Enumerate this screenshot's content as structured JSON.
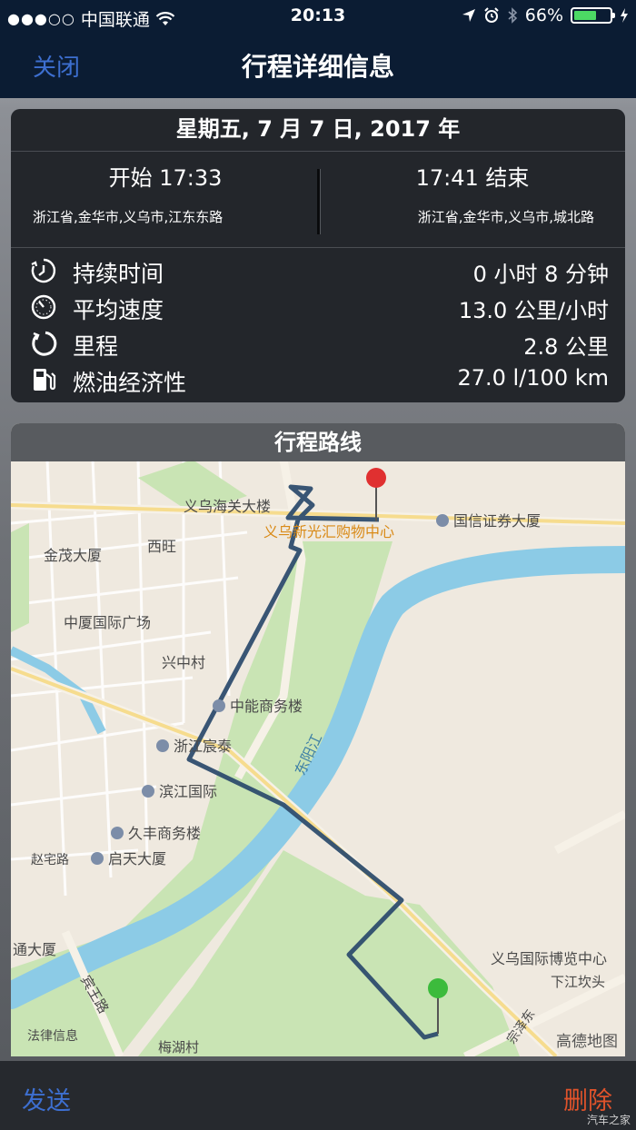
{
  "status_bar": {
    "carrier": "中国联通",
    "time": "20:13",
    "battery": "66%",
    "battery_level": 0.66
  },
  "nav": {
    "close_label": "关闭",
    "title": "行程详细信息"
  },
  "trip": {
    "date": "星期五, 7 月 7 日, 2017 年",
    "start_time": "开始 17:33",
    "end_time": "17:41 结束",
    "start_address": "浙江省,金华市,义乌市,江东东路",
    "end_address": "浙江省,金华市,义乌市,城北路"
  },
  "stats": [
    {
      "icon": "stopwatch-icon",
      "label": "持续时间",
      "value": "0 小时 8 分钟"
    },
    {
      "icon": "speedometer-icon",
      "label": "平均速度",
      "value": "13.0 公里/小时"
    },
    {
      "icon": "odometer-icon",
      "label": "里程",
      "value": "2.8 公里"
    },
    {
      "icon": "fuel-pump-icon",
      "label": "燃油经济性",
      "value": "27.0 l/100 km"
    }
  ],
  "map": {
    "title": "行程路线",
    "labels": {
      "customs": "义乌海关大楼",
      "mall": "义乌新光汇购物中心",
      "guoxin": "国信证券大厦",
      "xiwang": "西旺",
      "jinmao": "金茂大厦",
      "zhongxia": "中厦国际广场",
      "xingzhong": "兴中村",
      "zhongneng": "中能商务楼",
      "river": "东阳江",
      "chentai": "浙江宸泰",
      "binjiang": "滨江国际",
      "jiufeng": "久丰商务楼",
      "zhaizhai": "赵宅路",
      "qitian": "启天大厦",
      "tong": "通大厦",
      "expo": "义乌国际博览中心",
      "xiajiang": "下江坎头",
      "bin_road": "宾王路",
      "law": "法律信息",
      "meihu": "梅湖村",
      "zongze": "宗泽东",
      "gaode": "高德地图"
    }
  },
  "toolbar": {
    "send_label": "发送",
    "delete_label": "删除",
    "watermark": "汽车之家"
  }
}
